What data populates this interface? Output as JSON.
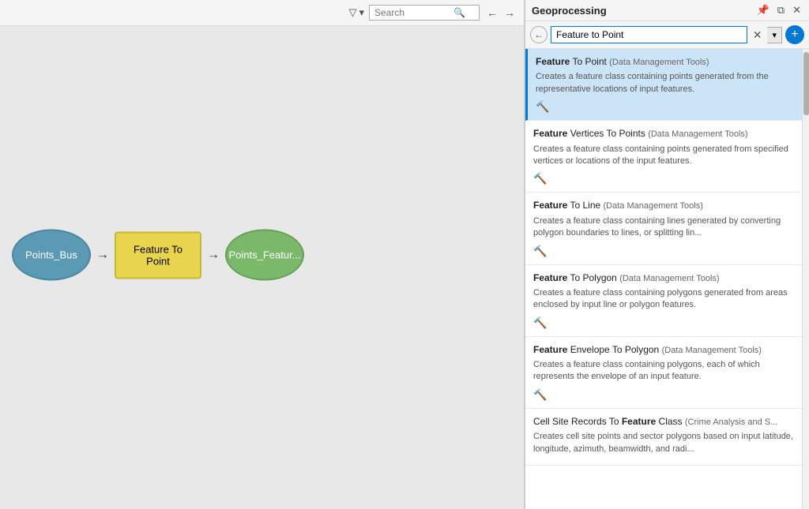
{
  "leftPanel": {
    "toolbar": {
      "filterLabel": "▾",
      "searchPlaceholder": "Search",
      "navBack": "←",
      "navForward": "→"
    },
    "diagram": {
      "nodes": [
        {
          "id": "input",
          "label": "Points_Bus",
          "type": "input"
        },
        {
          "id": "tool",
          "label": "Feature To Point",
          "type": "tool"
        },
        {
          "id": "output",
          "label": "Points_Featur...",
          "type": "output"
        }
      ],
      "arrows": [
        "→",
        "→"
      ]
    }
  },
  "rightPanel": {
    "title": "Geoprocessing",
    "headerControls": {
      "pin": "📌",
      "float": "⧉",
      "close": "✕"
    },
    "searchBar": {
      "backLabel": "←",
      "searchValue": "Feature to Point",
      "clearLabel": "✕",
      "dropdownLabel": "▾",
      "addLabel": "+"
    },
    "results": [
      {
        "id": "result-1",
        "titleBold": "Feature",
        "titleRest": " To Point",
        "source": "(Data Management Tools)",
        "desc": "Creates a feature class containing points generated from the representative locations of input features.",
        "selected": true
      },
      {
        "id": "result-2",
        "titleBold": "Feature",
        "titleRest": " Vertices To Points",
        "source": "(Data Management Tools)",
        "desc": "Creates a feature class containing points generated from specified vertices or locations of the input features.",
        "selected": false
      },
      {
        "id": "result-3",
        "titleBold": "Feature",
        "titleRest": " To Line",
        "source": "(Data Management Tools)",
        "desc": "Creates a feature class containing lines generated by converting polygon boundaries to lines, or splitting lin...",
        "selected": false
      },
      {
        "id": "result-4",
        "titleBold": "Feature",
        "titleRest": " To Polygon",
        "source": "(Data Management Tools)",
        "desc": "Creates a feature class containing polygons generated from areas enclosed by input line or polygon features.",
        "selected": false
      },
      {
        "id": "result-5",
        "titleBold": "Feature",
        "titleRest": " Envelope To Polygon",
        "source": "(Data Management Tools)",
        "desc": "Creates a feature class containing polygons, each of which represents the envelope of an input feature.",
        "selected": false
      },
      {
        "id": "result-6",
        "titleBold": "Cell Site Records To ",
        "titleRest": "Feature",
        "titleEnd": " Class",
        "source": "(Crime Analysis and S...",
        "desc": "Creates cell site points and sector polygons based on input latitude, longitude, azimuth, beamwidth, and radi...",
        "selected": false
      }
    ]
  }
}
